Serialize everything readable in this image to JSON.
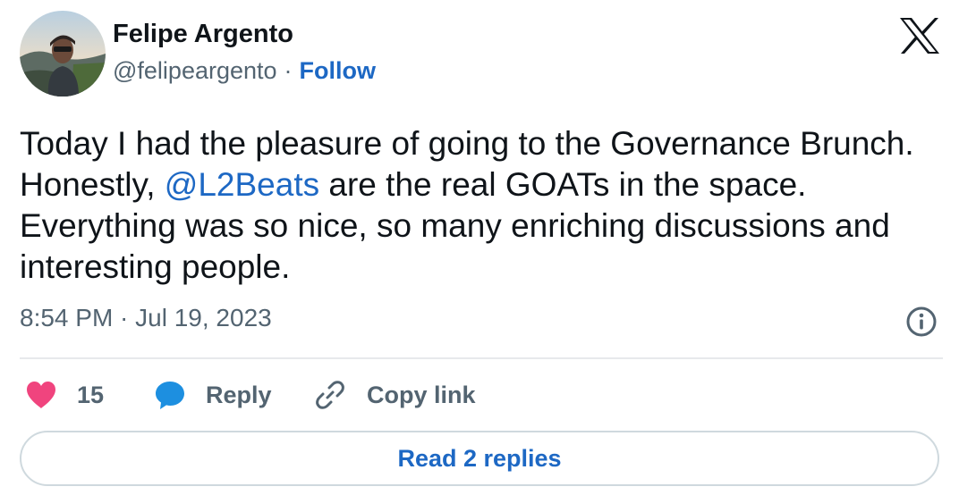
{
  "author": {
    "name": "Felipe Argento",
    "handle": "@felipeargento",
    "separator": "·",
    "follow_label": "Follow"
  },
  "tweet": {
    "text_before": "Today I had the pleasure of going to the Governance Brunch. Honestly, ",
    "mention": "@L2Beats",
    "text_after": " are the real GOATs in the space. Everything was so nice, so many enriching discussions and interesting people.",
    "timestamp": "8:54 PM · Jul 19, 2023"
  },
  "actions": {
    "like_count": "15",
    "reply_label": "Reply",
    "copy_link_label": "Copy link"
  },
  "footer": {
    "read_replies_label": "Read 2 replies"
  },
  "icons": {
    "close": "x-logo-icon",
    "info": "info-icon",
    "like": "heart-icon",
    "reply": "speech-bubble-icon",
    "copy": "link-icon"
  },
  "colors": {
    "accent": "#1d68c4",
    "heart": "#f0447e",
    "reply_bubble": "#1d8fe0",
    "muted_text": "#536471"
  }
}
